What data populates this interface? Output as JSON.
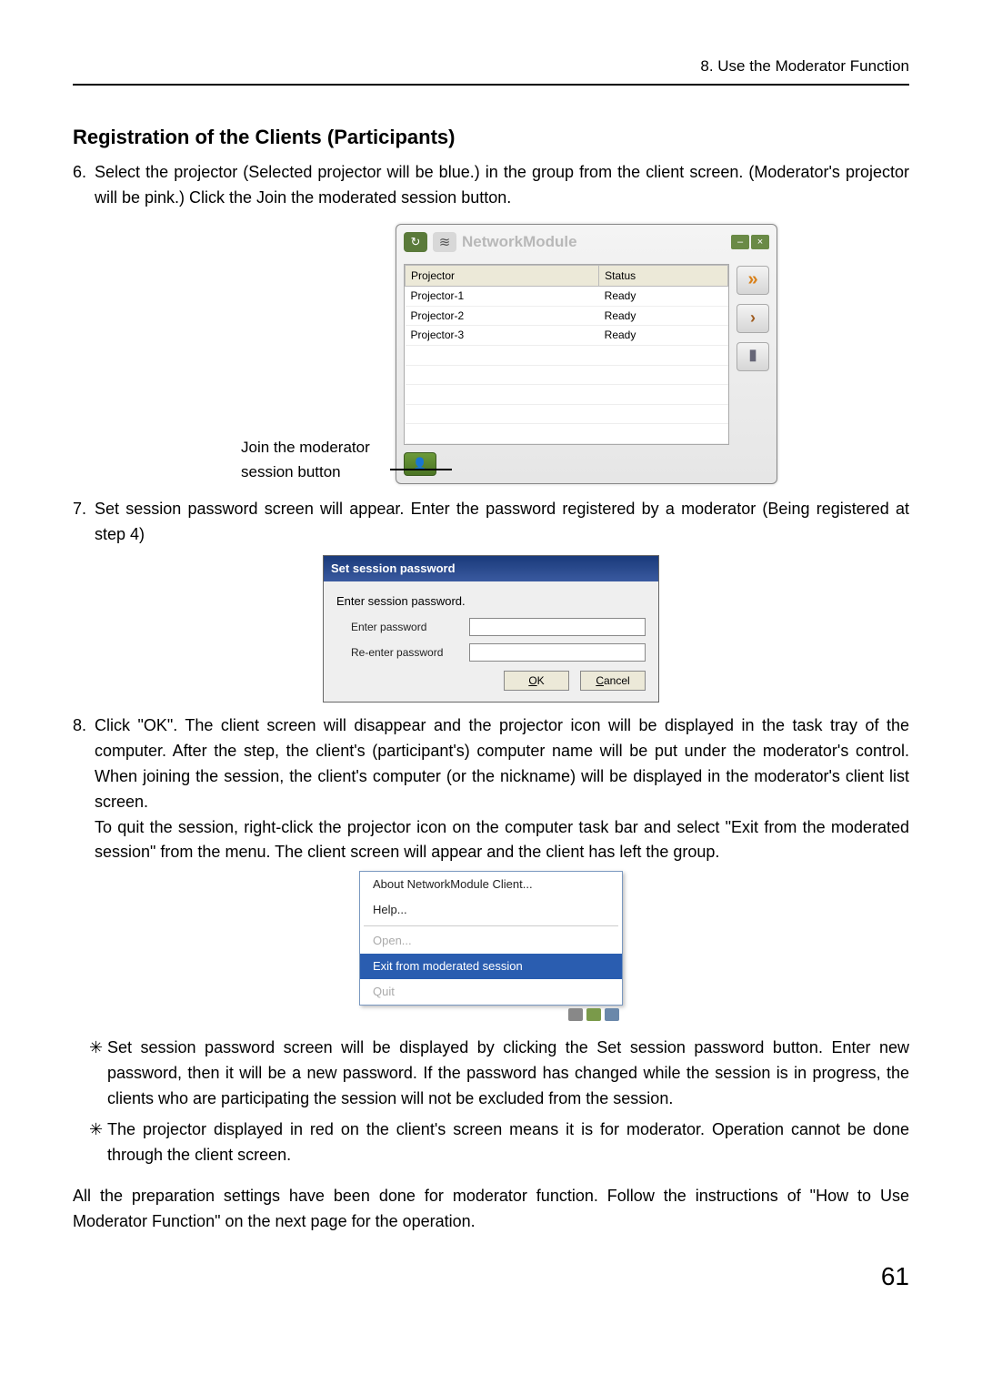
{
  "header": {
    "chapter": "8. Use the Moderator Function"
  },
  "section_title": "Registration of the Clients (Participants)",
  "steps": {
    "s6_num": "6.",
    "s6": "Select the projector (Selected projector will be blue.) in the group from the client screen. (Moderator's projector will be pink.) Click the Join the moderated session button.",
    "s7_num": "7.",
    "s7": "Set session password screen will appear. Enter the password registered by a moderator (Being registered at step 4)",
    "s8_num": "8.",
    "s8a": "Click \"OK\". The client screen will disappear and the projector icon will be displayed in the task tray of the computer. After the step, the client's (participant's) computer name will be put under the moderator's control. When joining the session, the client's computer (or the nickname) will be displayed in the moderator's client list screen.",
    "s8b": "To quit the session, right-click the projector icon on the computer task bar and select \"Exit from the moderated session\" from the menu. The client screen will appear and the client has left the group."
  },
  "join_caption_l1": "Join the moderator",
  "join_caption_l2": "session button",
  "nm": {
    "title": "NetworkModule",
    "col_projector": "Projector",
    "col_status": "Status",
    "rows": [
      {
        "name": "Projector-1",
        "status": "Ready"
      },
      {
        "name": "Projector-2",
        "status": "Ready"
      },
      {
        "name": "Projector-3",
        "status": "Ready"
      }
    ],
    "icons": {
      "refresh": "↻",
      "wifi": "≋",
      "min": "–",
      "close": "×",
      "connect": "»",
      "play": "›",
      "building": "▮",
      "join": "👤"
    }
  },
  "pwd": {
    "title": "Set session password",
    "label_enter": "Enter session password.",
    "label_pw": "Enter password",
    "label_repw": "Re-enter password",
    "ok_u": "O",
    "ok_rest": "K",
    "cancel_u": "C",
    "cancel_rest": "ancel"
  },
  "ctx": {
    "about": "About NetworkModule Client...",
    "help": "Help...",
    "open": "Open...",
    "exit": "Exit from moderated session",
    "quit": "Quit"
  },
  "notes": {
    "star": "✳",
    "n1": "Set session password screen will be displayed by clicking the Set session password button. Enter new password, then it will be a new password. If the password has changed while the session is in progress, the clients who are participating the session will not be excluded from the session.",
    "n2": "The projector displayed in red on the client's screen means it is for moderator. Operation cannot be done through the client screen."
  },
  "closing": "All the preparation settings have been done for moderator function. Follow the instructions of \"How to Use Moderator Function\" on the next page for the operation.",
  "page_number": "61"
}
